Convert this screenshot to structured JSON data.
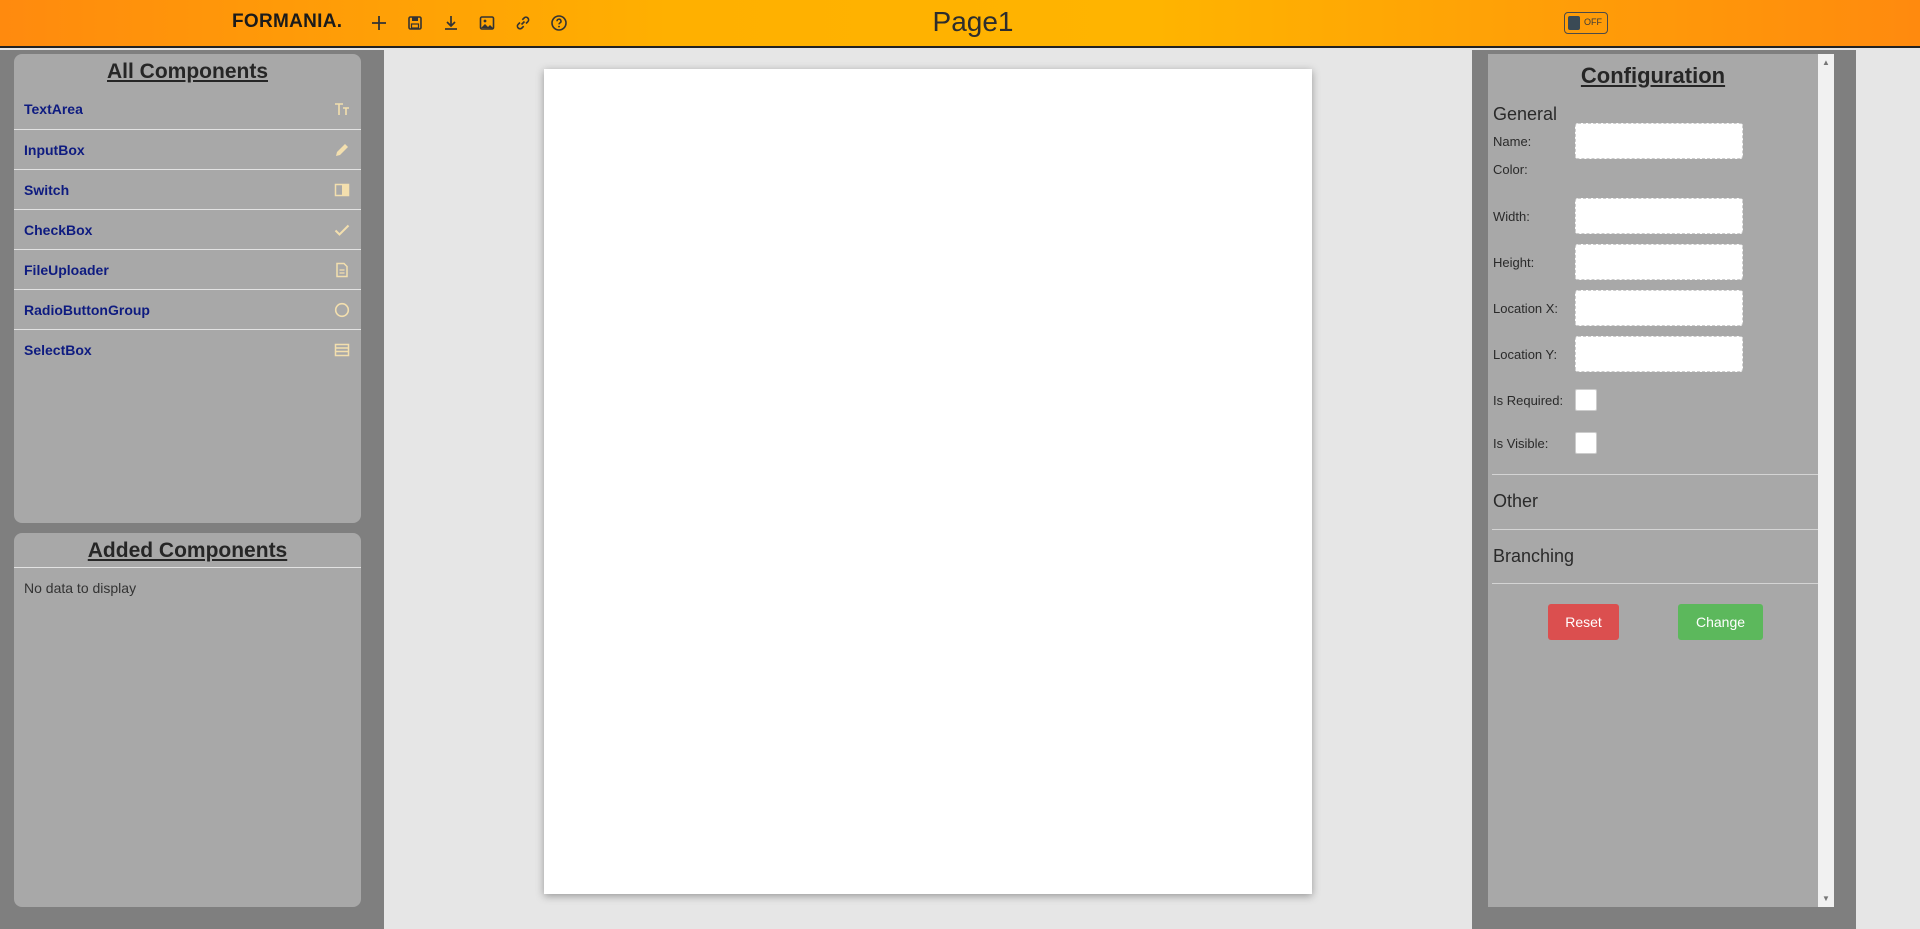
{
  "app": {
    "brand": "FORMANIA.",
    "page_title": "Page1",
    "toggle_label": "OFF",
    "toolbar": [
      "add-icon",
      "save-icon",
      "download-icon",
      "image-icon",
      "link-icon",
      "help-icon"
    ]
  },
  "all_components": {
    "title": "All Components",
    "items": [
      {
        "label": "TextArea",
        "icon": "text-size-icon"
      },
      {
        "label": "InputBox",
        "icon": "pencil-icon"
      },
      {
        "label": "Switch",
        "icon": "switch-icon"
      },
      {
        "label": "CheckBox",
        "icon": "check-icon"
      },
      {
        "label": "FileUploader",
        "icon": "file-icon"
      },
      {
        "label": "RadioButtonGroup",
        "icon": "radio-circle-icon"
      },
      {
        "label": "SelectBox",
        "icon": "list-icon"
      }
    ]
  },
  "added_components": {
    "title": "Added Components",
    "empty_text": "No data to display"
  },
  "configuration": {
    "title": "Configuration",
    "general": {
      "title": "General",
      "name_label": "Name:",
      "color_label": "Color:",
      "width_label": "Width:",
      "height_label": "Height:",
      "location_x_label": "Location X:",
      "location_y_label": "Location Y:",
      "required_label": "Is Required:",
      "visible_label": "Is Visible:"
    },
    "other_title": "Other",
    "branching_title": "Branching",
    "reset_label": "Reset",
    "change_label": "Change"
  },
  "colors": {
    "topbar_gradient": [
      "#ff8a0e",
      "#ffb000"
    ],
    "panel_bg": "#a8a8a8",
    "side_bg": "#7f7f7f",
    "component_text": "#0e1b80",
    "icon_color": "#f3dfae",
    "reset": "#db4f4f",
    "change": "#5cb85c"
  }
}
